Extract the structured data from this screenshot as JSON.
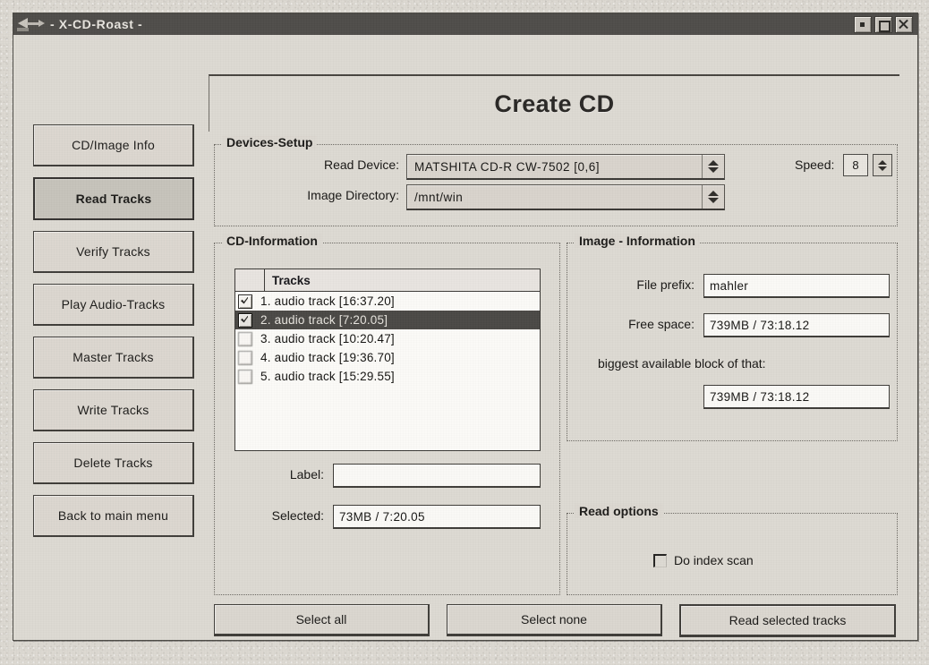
{
  "window": {
    "title": "- X-CD-Roast -",
    "icon": "xcdroast-logo-icon",
    "buttons": {
      "minimize": "minimize-button",
      "maximize": "maximize-button",
      "close": "close-button"
    }
  },
  "banner": {
    "title": "Create CD"
  },
  "sidebar": {
    "items": [
      {
        "label": "CD/Image Info",
        "active": false
      },
      {
        "label": "Read Tracks",
        "active": true
      },
      {
        "label": "Verify Tracks",
        "active": false
      },
      {
        "label": "Play Audio-Tracks",
        "active": false
      },
      {
        "label": "Master Tracks",
        "active": false
      },
      {
        "label": "Write Tracks",
        "active": false
      },
      {
        "label": "Delete Tracks",
        "active": false
      },
      {
        "label": "Back to main menu",
        "active": false
      }
    ]
  },
  "devices_setup": {
    "legend": "Devices-Setup",
    "read_device": {
      "label": "Read Device:",
      "value": "MATSHITA CD-R   CW-7502   [0,6]"
    },
    "image_directory": {
      "label": "Image Directory:",
      "value": "/mnt/win"
    },
    "speed": {
      "label": "Speed:",
      "value": "8"
    }
  },
  "cd_information": {
    "legend": "CD-Information",
    "column_header": "Tracks",
    "tracks": [
      {
        "checked": true,
        "selected": false,
        "label": "1. audio track [16:37.20]"
      },
      {
        "checked": true,
        "selected": true,
        "label": "2. audio track [7:20.05]"
      },
      {
        "checked": false,
        "selected": false,
        "label": "3. audio track [10:20.47]"
      },
      {
        "checked": false,
        "selected": false,
        "label": "4. audio track [19:36.70]"
      },
      {
        "checked": false,
        "selected": false,
        "label": "5. audio track [15:29.55]"
      }
    ],
    "label_field": {
      "label": "Label:",
      "value": ""
    },
    "selected_field": {
      "label": "Selected:",
      "value": "73MB / 7:20.05"
    }
  },
  "image_information": {
    "legend": "Image - Information",
    "file_prefix": {
      "label": "File prefix:",
      "value": "mahler"
    },
    "free_space": {
      "label": "Free space:",
      "value": "739MB / 73:18.12"
    },
    "biggest_block": {
      "label": "biggest available block of that:",
      "value": "739MB / 73:18.12"
    }
  },
  "read_options": {
    "legend": "Read options",
    "do_index_scan": {
      "label": "Do index scan",
      "checked": false
    }
  },
  "bottom_buttons": {
    "select_all": "Select all",
    "select_none": "Select none",
    "read_selected": "Read selected tracks"
  },
  "colors": {
    "window_background": "#dedad3",
    "titlebar": "#4f4d49",
    "selection": "#4a4845",
    "text": "#171614"
  }
}
